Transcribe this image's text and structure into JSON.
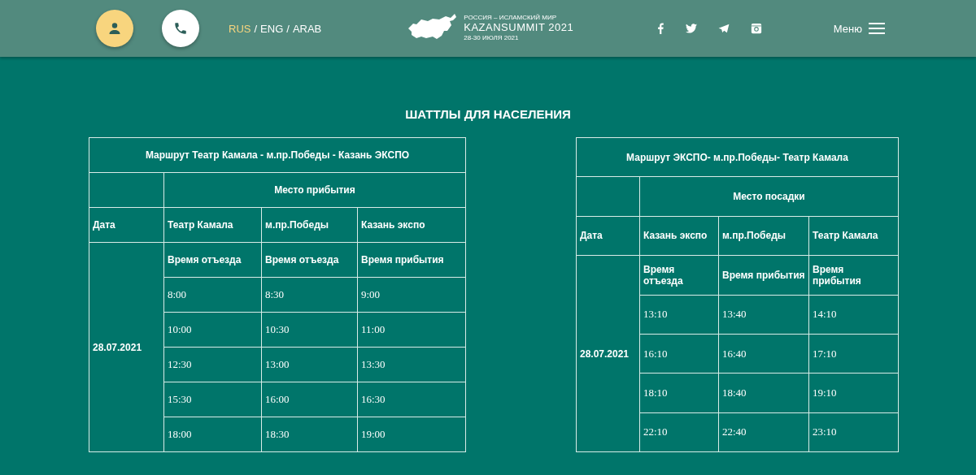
{
  "header": {
    "languages": [
      {
        "label": "RUS",
        "selected": true
      },
      {
        "label": "ENG",
        "selected": false
      },
      {
        "label": "ARAB",
        "selected": false
      }
    ],
    "language_separator": "/",
    "logo": {
      "line_1": "РОССИЯ – ИСЛАМСКИЙ МИР",
      "line_2": "KAZANSUMMIT 2021",
      "line_3": "28-30 ИЮЛЯ 2021"
    },
    "menu_label": "Меню"
  },
  "page_title": "ШАТТЛЫ ДЛЯ НАСЕЛЕНИЯ",
  "tables": [
    {
      "title": "Маршрут Театр Камала - м.пр.Победы - Казань ЭКСПО",
      "group_header": "Место прибытия",
      "date_label": "Дата",
      "stops": [
        "Театр Камала",
        "м.пр.Победы",
        "Казань экспо"
      ],
      "time_labels": [
        "Время отъезда",
        "Время отъезда",
        "Время прибытия"
      ],
      "date": "28.07.2021",
      "rows": [
        [
          "8:00",
          "8:30",
          "9:00"
        ],
        [
          "10:00",
          "10:30",
          "11:00"
        ],
        [
          "12:30",
          "13:00",
          "13:30"
        ],
        [
          "15:30",
          "16:00",
          "16:30"
        ],
        [
          "18:00",
          "18:30",
          "19:00"
        ]
      ]
    },
    {
      "title": "Маршрут ЭКСПО- м.пр.Победы- Театр Камала",
      "group_header": "Место посадки",
      "date_label": "Дата",
      "stops": [
        "Казань экспо",
        "м.пр.Победы",
        "Театр Камала"
      ],
      "time_labels": [
        "Время отъезда",
        "Время прибытия",
        "Время прибытия"
      ],
      "date": "28.07.2021",
      "rows": [
        [
          "13:10",
          "13:40",
          "14:10"
        ],
        [
          "16:10",
          "16:40",
          "17:10"
        ],
        [
          "18:10",
          "18:40",
          "19:10"
        ],
        [
          "22:10",
          "22:40",
          "23:10"
        ]
      ]
    }
  ]
}
